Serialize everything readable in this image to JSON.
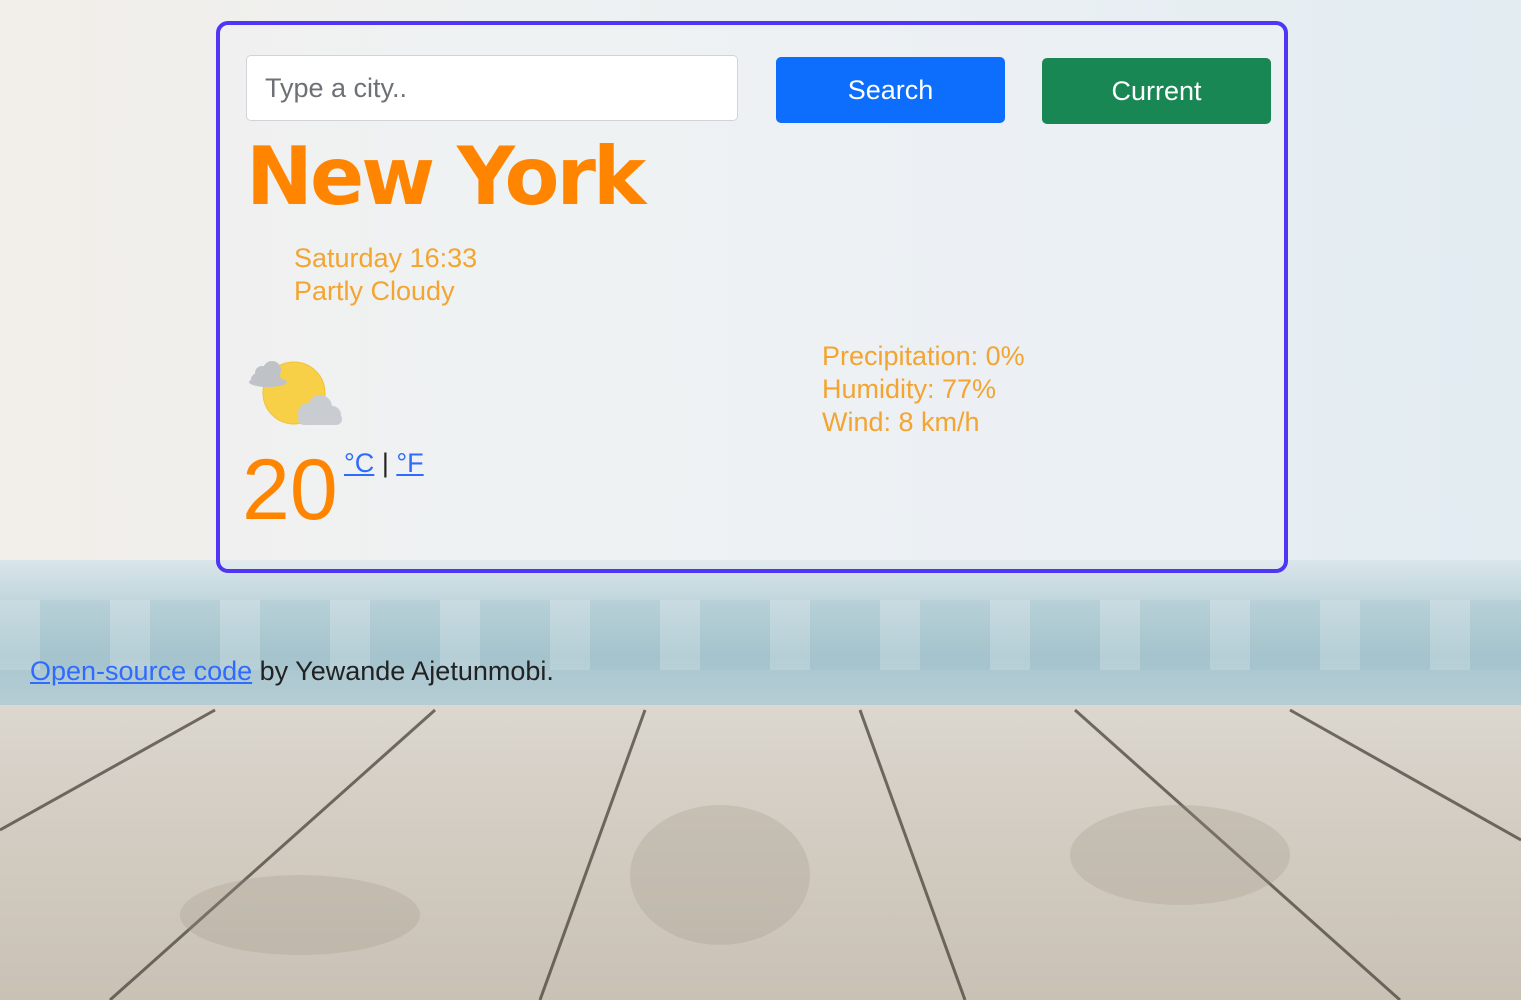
{
  "search": {
    "placeholder": "Type a city..",
    "value": ""
  },
  "buttons": {
    "search_label": "Search",
    "current_label": "Current"
  },
  "weather": {
    "city": "New York",
    "datetime": "Saturday 16:33",
    "condition": "Partly Cloudy",
    "icon": "partly-cloudy-icon",
    "temperature": "20",
    "unit_celsius": "°C",
    "unit_separator": "|",
    "unit_fahrenheit": "°F",
    "precipitation": "Precipitation: 0%",
    "humidity": "Humidity: 77%",
    "wind": "Wind: 8 km/h"
  },
  "footer": {
    "link_text": "Open-source code",
    "text": " by Yewande Ajetunmobi."
  },
  "colors": {
    "card_border": "#5035f5",
    "accent_orange": "#ff8500",
    "detail_text": "#f3a431",
    "search_button": "#0d6efd",
    "current_button": "#198754",
    "link": "#2f6bff"
  }
}
